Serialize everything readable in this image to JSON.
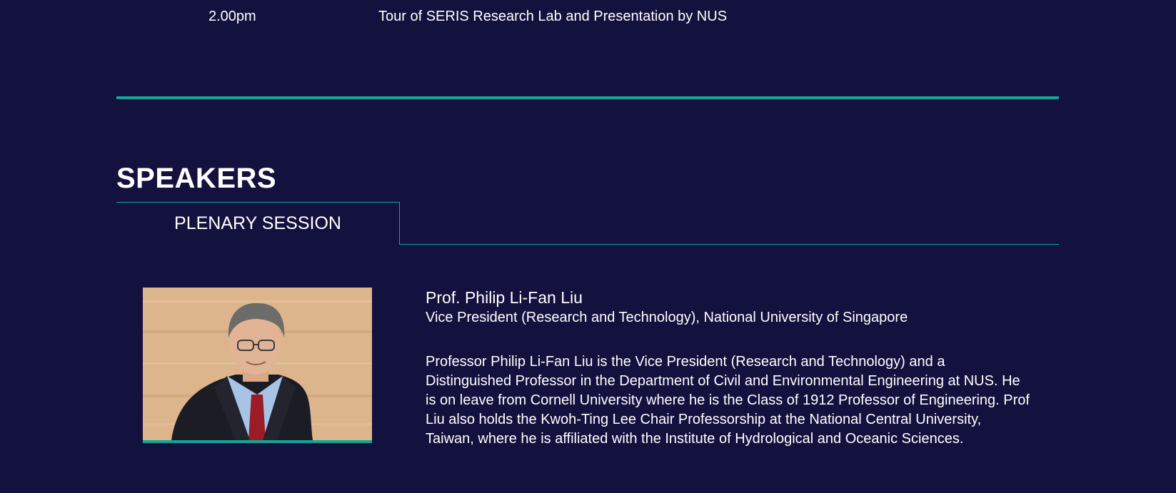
{
  "schedule": {
    "time": "2.00pm",
    "description": "Tour of SERIS Research Lab and Presentation by NUS"
  },
  "speakers": {
    "heading": "SPEAKERS",
    "tabs": [
      {
        "label": "PLENARY SESSION",
        "active": true
      }
    ],
    "speaker": {
      "name": "Prof. Philip Li-Fan Liu",
      "title": "Vice President (Research and Technology), National University of Singapore",
      "bio": "Professor Philip Li-Fan Liu is the Vice President (Research and Technology) and a Distinguished Professor in the Department of Civil and Environmental Engineering at NUS. He is on leave from Cornell University where he is the Class of 1912 Professor of Engineering. Prof Liu also holds the Kwoh-Ting Lee Chair Professorship at the National Central University, Taiwan, where he is affiliated with the Institute of Hydrological and Oceanic Sciences."
    }
  },
  "colors": {
    "background": "#13113d",
    "accent": "#13a698",
    "text": "#ffffff"
  }
}
